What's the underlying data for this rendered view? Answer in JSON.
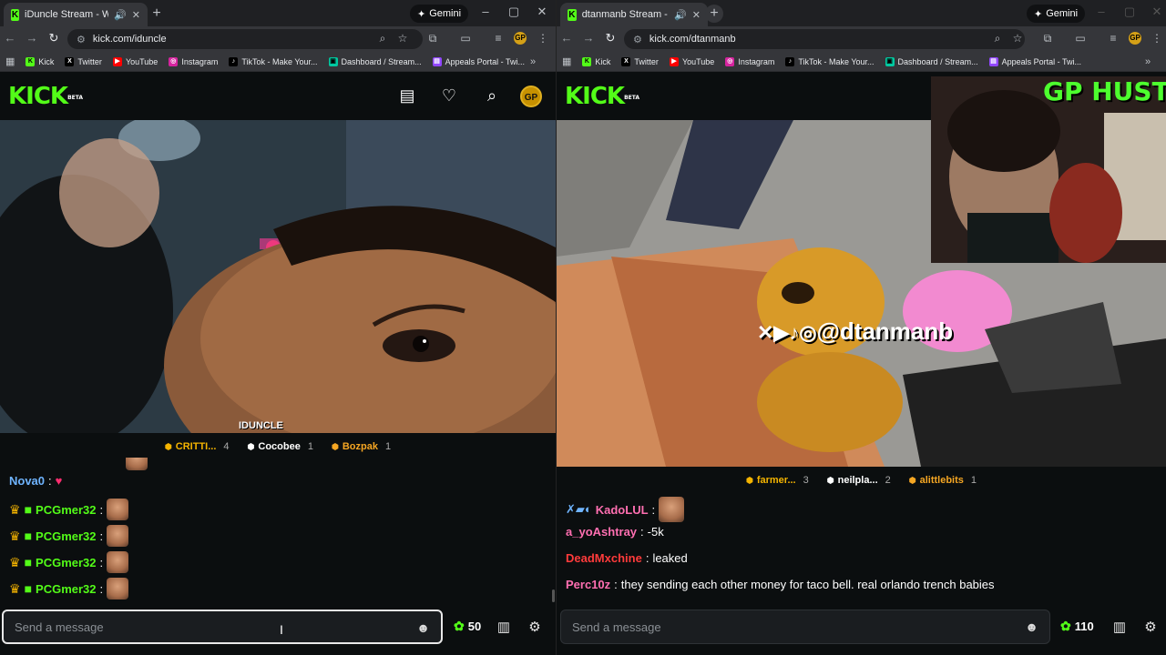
{
  "left": {
    "tab_title": "iDuncle Stream - Watch Liv",
    "url": "kick.com/iduncle",
    "gemini": "Gemini",
    "bookmarks": [
      "Kick",
      "Twitter",
      "YouTube",
      "Instagram",
      "TikTok - Make Your...",
      "Dashboard / Stream...",
      "Appeals Portal - Twi..."
    ],
    "logo": "KICK",
    "logo_beta": "BETA",
    "avatar": "GP",
    "watermark": "IDUNCLE",
    "leaderboard": [
      {
        "name": "CRITTI...",
        "count": "4",
        "color": "#f5b400"
      },
      {
        "name": "Cocobee",
        "count": "1",
        "color": "#ffffff"
      },
      {
        "name": "Bozpak",
        "count": "1",
        "color": "#f5b400"
      }
    ],
    "chat": [
      {
        "user": "Nova0",
        "text": "♥",
        "user_color": "#6fb4ff"
      },
      {
        "user": "PCGmer32",
        "text": "",
        "user_color": "#53fc18"
      },
      {
        "user": "PCGmer32",
        "text": "",
        "user_color": "#53fc18"
      },
      {
        "user": "PCGmer32",
        "text": "",
        "user_color": "#53fc18"
      },
      {
        "user": "PCGmer32",
        "text": "",
        "user_color": "#53fc18"
      }
    ],
    "input_placeholder": "Send a message",
    "points": "50"
  },
  "right": {
    "tab_title": "dtanmanb Stream - Watch",
    "url": "kick.com/dtanmanb",
    "gemini": "Gemini",
    "bookmarks": [
      "Kick",
      "Twitter",
      "YouTube",
      "Instagram",
      "TikTok - Make Your...",
      "Dashboard / Stream...",
      "Appeals Portal - Twi..."
    ],
    "logo": "KICK",
    "logo_beta": "BETA",
    "cam_title": "GP HUSTLA",
    "watermark": "@dtanmanb",
    "leaderboard": [
      {
        "name": "farmer...",
        "count": "3",
        "color": "#f5b400"
      },
      {
        "name": "neilpla...",
        "count": "2",
        "color": "#ffffff"
      },
      {
        "name": "alittlebits",
        "count": "1",
        "color": "#f5b400"
      }
    ],
    "chat": [
      {
        "user": "KadoLUL",
        "text": "",
        "user_color": "#ff6fb1"
      },
      {
        "user": "a_yoAshtray",
        "text": "-5k",
        "user_color": "#ff6fb1"
      },
      {
        "user": "DeadMxchine",
        "text": "leaked",
        "user_color": "#ff3b3b"
      },
      {
        "user": "Perc10z",
        "text": "they sending each other money for taco bell. real orlando trench babies",
        "user_color": "#ff6fb1"
      }
    ],
    "input_placeholder": "Send a message",
    "points": "110"
  }
}
